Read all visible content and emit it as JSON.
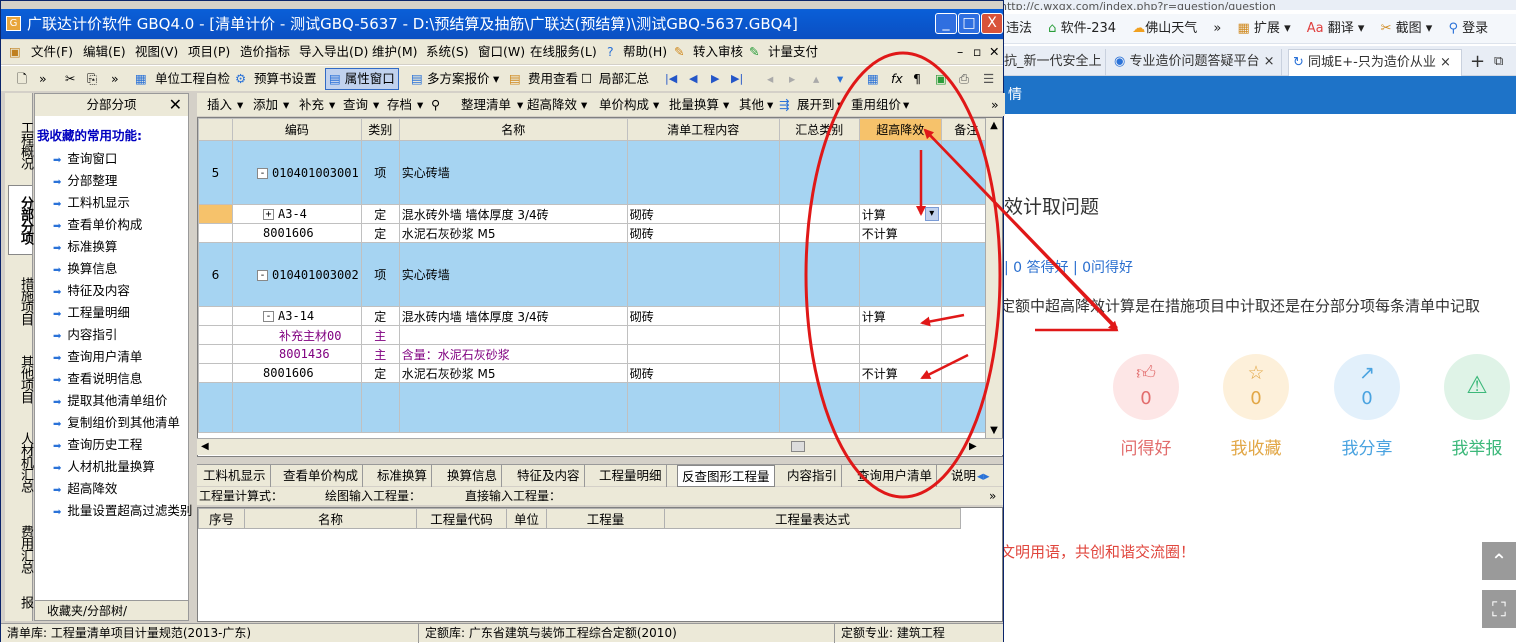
{
  "browser": {
    "url_fragment": "http://c.wxgx.com/index.php?r=question/question",
    "bookmarks": [
      "违法",
      "软件-234",
      "佛山天气",
      "»",
      "扩展",
      "翻译",
      "截图",
      "登录"
    ],
    "tabs": [
      {
        "label": "抗_新一代安全上"
      },
      {
        "label": "专业造价问题答疑平台"
      },
      {
        "label": "同城E+-只为造价从业"
      }
    ],
    "header_text": "情",
    "question_title": "效计取问题",
    "stats": "| 0 答得好 | 0问得好",
    "question_text": "定额中超高降效计算是在措施项目中计取还是在分部分项每条清单中记取",
    "actions": [
      {
        "label": "问得好",
        "count": "0",
        "icon": "thumbs-up-icon",
        "color": "#e26d6d",
        "bg": "#fde6e6"
      },
      {
        "label": "我收藏",
        "count": "0",
        "icon": "star-icon",
        "color": "#e2a746",
        "bg": "#fdf0da"
      },
      {
        "label": "我分享",
        "count": "0",
        "icon": "share-icon",
        "color": "#4aa3e0",
        "bg": "#e2f0fb"
      },
      {
        "label": "我举报",
        "count": "",
        "icon": "warning-icon",
        "color": "#3cb87a",
        "bg": "#dff3e7"
      }
    ],
    "civil_text": "文明用语，共创和谐交流圈！"
  },
  "window": {
    "title": "广联达计价软件 GBQ4.0 - [清单计价 - 测试GBQ-5637 - D:\\预结算及抽筋\\广联达(预结算)\\测试GBQ-5637.GBQ4]",
    "minimize": "_",
    "maximize": "□",
    "close": "X"
  },
  "menu": [
    "文件(F)",
    "编辑(E)",
    "视图(V)",
    "项目(P)",
    "造价指标",
    "导入导出(D)",
    "维护(M)",
    "系统(S)",
    "窗口(W)",
    "在线服务(L)",
    "帮助(H)",
    "转入审核",
    "计量支付"
  ],
  "toolbar": [
    "单位工程自检",
    "预算书设置",
    "属性窗口",
    "多方案报价",
    "费用查看",
    "局部汇总"
  ],
  "vertical_tabs": [
    "工程概况",
    "分部分项",
    "措施项目",
    "其他项目",
    "人材机汇总",
    "费用汇总",
    "报"
  ],
  "favorites": {
    "header": "分部分项",
    "close": "✕",
    "subtitle": "我收藏的常用功能:",
    "items": [
      "查询窗口",
      "分部整理",
      "工料机显示",
      "查看单价构成",
      "标准换算",
      "换算信息",
      "特征及内容",
      "工程量明细",
      "内容指引",
      "查询用户清单",
      "查看说明信息",
      "提取其他清单组价",
      "复制组价到其他清单",
      "查询历史工程",
      "人材机批量换算",
      "超高降效",
      "批量设置超高过滤类别"
    ],
    "bottom_tabs": "收藏夹/分部树/"
  },
  "grid_toolbar": [
    "插入",
    "添加",
    "补充",
    "查询",
    "存档",
    "整理清单",
    "超高降效",
    "单价构成",
    "批量换算",
    "其他",
    "展开到",
    "重用组价",
    "»"
  ],
  "grid": {
    "columns": [
      "",
      "编码",
      "类别",
      "名称",
      "清单工程内容",
      "汇总类别",
      "超高降效",
      "备注"
    ],
    "rows": [
      {
        "kind": "item",
        "no": "5",
        "code": "010401003001",
        "type": "项",
        "name": "实心砖墙",
        "content": "",
        "summary": "",
        "super": "",
        "note": "",
        "tog": "-"
      },
      {
        "kind": "sub",
        "no": "",
        "code": "A3-4",
        "type": "定",
        "name": "混水砖外墙 墙体厚度 3/4砖",
        "content": "砌砖",
        "summary": "",
        "super": "计算",
        "note": "",
        "tog": "+",
        "selected": true
      },
      {
        "kind": "sub",
        "no": "",
        "code": "8001606",
        "type": "定",
        "name": "水泥石灰砂浆 M5",
        "content": "砌砖",
        "summary": "",
        "super": "不计算",
        "note": "",
        "tog": ""
      },
      {
        "kind": "item",
        "no": "6",
        "code": "010401003002",
        "type": "项",
        "name": "实心砖墙",
        "content": "",
        "summary": "",
        "super": "",
        "note": "",
        "tog": "-"
      },
      {
        "kind": "sub",
        "no": "",
        "code": "A3-14",
        "type": "定",
        "name": "混水砖内墙 墙体厚度 3/4砖",
        "content": "砌砖",
        "summary": "",
        "super": "计算",
        "note": "",
        "tog": "-"
      },
      {
        "kind": "mat",
        "no": "",
        "code": "补充主材00",
        "type": "主",
        "name": "",
        "content": "",
        "summary": "",
        "super": "",
        "note": "",
        "tog": ""
      },
      {
        "kind": "mat",
        "no": "",
        "code": "8001436",
        "type": "主",
        "name": "含量：水泥石灰砂浆",
        "content": "",
        "summary": "",
        "super": "",
        "note": "",
        "tog": ""
      },
      {
        "kind": "sub",
        "no": "",
        "code": "8001606",
        "type": "定",
        "name": "水泥石灰砂浆 M5",
        "content": "砌砖",
        "summary": "",
        "super": "不计算",
        "note": "",
        "tog": ""
      }
    ]
  },
  "bottom_tabs": [
    "工料机显示",
    "查看单价构成",
    "标准换算",
    "换算信息",
    "特征及内容",
    "工程量明细",
    "反查图形工程量",
    "内容指引",
    "查询用户清单",
    "说明"
  ],
  "quantity_line": {
    "formula": "工程量计算式：",
    "drawing": "绘图输入工程量：",
    "direct": "直接输入工程量："
  },
  "lower_columns": [
    "序号",
    "名称",
    "工程量代码",
    "单位",
    "工程量",
    "工程量表达式"
  ],
  "status": {
    "list_lib": "清单库: 工程量清单项目计量规范(2013-广东)",
    "quota_lib": "定额库: 广东省建筑与装饰工程综合定额(2010)",
    "quota_major": "定额专业: 建筑工程"
  }
}
